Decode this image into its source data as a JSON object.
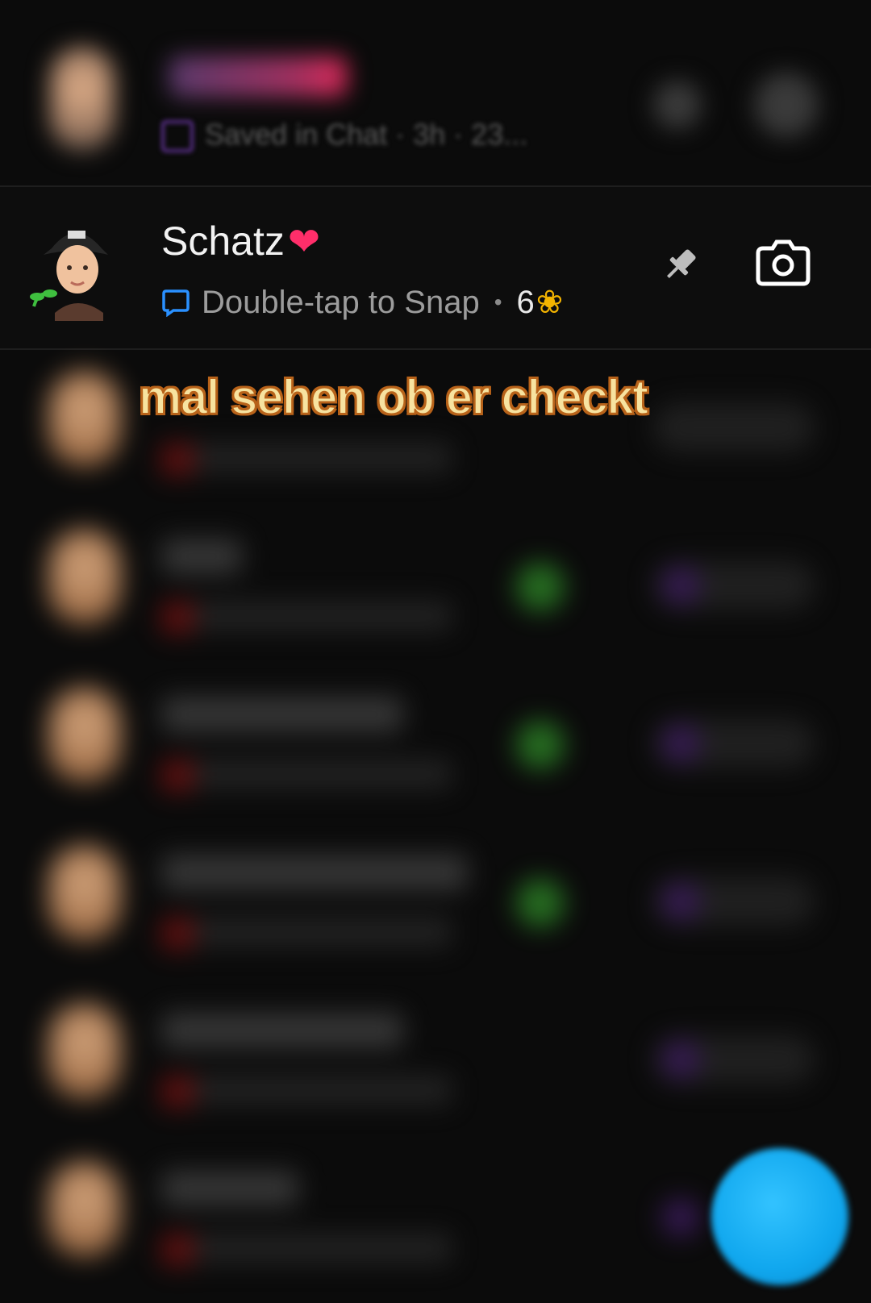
{
  "top_chat": {
    "subtitle": "Saved in Chat · 3h · 23..."
  },
  "focused_chat": {
    "name": "Schatz",
    "name_emoji": "❤",
    "status": "Double-tap to Snap",
    "separator": "•",
    "streak_count": "6",
    "streak_emoji": "❀",
    "icons": [
      "chat-bubble-icon",
      "pin-icon",
      "camera-icon"
    ]
  },
  "caption": "mal sehen ob er checkt",
  "colors": {
    "background": "#0b0b0b",
    "caption_fill": "#f7e3a0",
    "caption_stroke": "#b8631a",
    "accent_blue": "#10a7ee"
  }
}
